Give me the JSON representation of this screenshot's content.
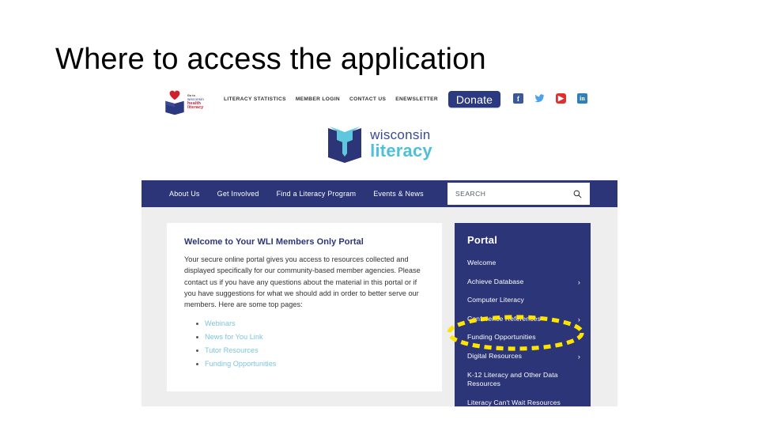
{
  "slide": {
    "title": "Where to access the application"
  },
  "site": {
    "utility": {
      "partner_logo": {
        "line1": "Go to",
        "line2": "wisconsin",
        "line3": "health",
        "line4": "literacy"
      },
      "nav": [
        {
          "label": "LITERACY STATISTICS"
        },
        {
          "label": "MEMBER LOGIN"
        },
        {
          "label": "CONTACT US"
        },
        {
          "label": "ENEWSLETTER"
        }
      ],
      "donate_label": "Donate",
      "social": [
        {
          "name": "facebook-icon",
          "glyph": "f"
        },
        {
          "name": "twitter-icon",
          "glyph": "ᵠ"
        },
        {
          "name": "youtube-icon",
          "glyph": "▶"
        },
        {
          "name": "linkedin-icon",
          "glyph": "in"
        }
      ]
    },
    "brand": {
      "line1": "wisconsin",
      "line2": "literacy"
    },
    "navbar": {
      "links": [
        {
          "label": "About Us"
        },
        {
          "label": "Get Involved"
        },
        {
          "label": "Find a Literacy Program"
        },
        {
          "label": "Events & News"
        }
      ],
      "search_placeholder": "SEARCH"
    },
    "content": {
      "heading": "Welcome to Your WLI Members Only Portal",
      "paragraph": "Your secure online portal gives you access to resources collected and displayed specifically for our community-based member agencies. Please contact us if you have any questions about the material in this portal or if you have suggestions for what we should add in order to better serve our members.  Here are some top pages:",
      "links": [
        {
          "label": "Webinars"
        },
        {
          "label": "News for You Link"
        },
        {
          "label": "Tutor Resources"
        },
        {
          "label": "Funding Opportunities"
        }
      ]
    },
    "portal": {
      "title": "Portal",
      "items": [
        {
          "label": "Welcome",
          "chevron": ""
        },
        {
          "label": "Achieve Database",
          "chevron": "›"
        },
        {
          "label": "Computer Literacy",
          "chevron": ""
        },
        {
          "label": "Conference References",
          "chevron": "›"
        },
        {
          "label": "Funding Opportunities",
          "chevron": ""
        },
        {
          "label": "Digital Resources",
          "chevron": "›"
        },
        {
          "label": "K-12 Literacy and Other Data Resources",
          "chevron": ""
        },
        {
          "label": "Literacy Can't Wait Resources",
          "chevron": ""
        }
      ]
    },
    "annotation": {
      "type": "dashed-ellipse-highlight",
      "color": "#ffe400",
      "targets": "K-12 Literacy and Other Data Resources"
    },
    "colors": {
      "navy": "#2b3578",
      "brand_cyan": "#4fc0d8",
      "link_blue": "#7ec5d9",
      "page_gray": "#eeeeee",
      "highlight_yellow": "#ffe400",
      "heart_red": "#cf2030"
    }
  }
}
